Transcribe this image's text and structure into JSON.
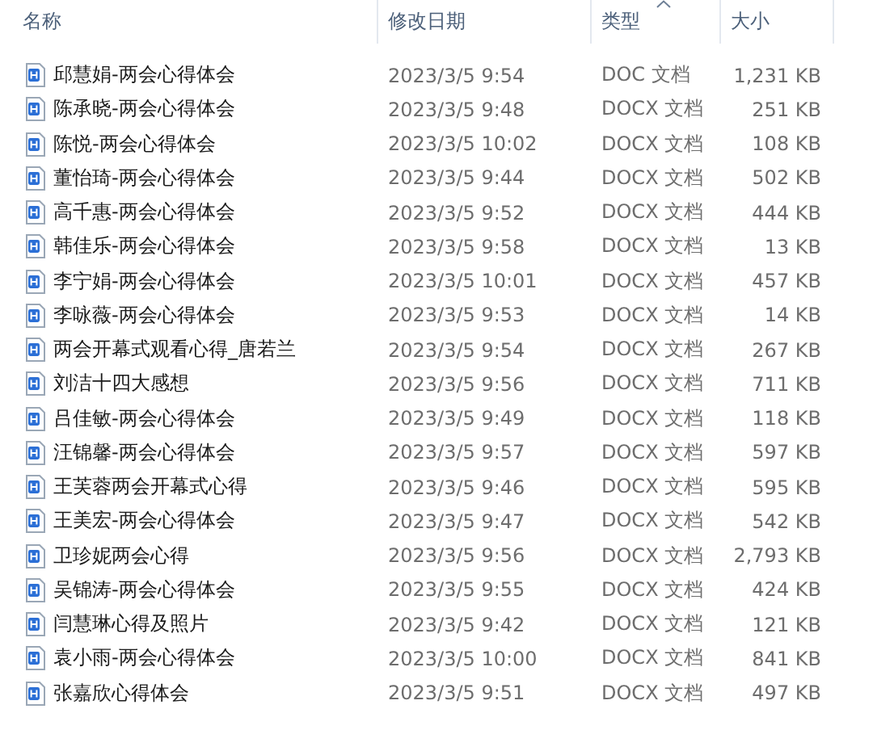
{
  "columns": [
    {
      "label": "名称",
      "sorted": false
    },
    {
      "label": "修改日期",
      "sorted": false
    },
    {
      "label": "类型",
      "sorted": true
    },
    {
      "label": "大小",
      "sorted": false
    }
  ],
  "rows": [
    {
      "name": "邱慧娟-两会心得体会",
      "modified": "2023/3/5 9:54",
      "type": "DOC 文档",
      "size": "1,231 KB"
    },
    {
      "name": "陈承晓-两会心得体会",
      "modified": "2023/3/5 9:48",
      "type": "DOCX 文档",
      "size": "251 KB"
    },
    {
      "name": "陈悦-两会心得体会",
      "modified": "2023/3/5 10:02",
      "type": "DOCX 文档",
      "size": "108 KB"
    },
    {
      "name": "董怡琦-两会心得体会",
      "modified": "2023/3/5 9:44",
      "type": "DOCX 文档",
      "size": "502 KB"
    },
    {
      "name": "高千惠-两会心得体会",
      "modified": "2023/3/5 9:52",
      "type": "DOCX 文档",
      "size": "444 KB"
    },
    {
      "name": "韩佳乐-两会心得体会",
      "modified": "2023/3/5 9:58",
      "type": "DOCX 文档",
      "size": "13 KB"
    },
    {
      "name": "李宁娟-两会心得体会",
      "modified": "2023/3/5 10:01",
      "type": "DOCX 文档",
      "size": "457 KB"
    },
    {
      "name": "李咏薇-两会心得体会",
      "modified": "2023/3/5 9:53",
      "type": "DOCX 文档",
      "size": "14 KB"
    },
    {
      "name": "两会开幕式观看心得_唐若兰",
      "modified": "2023/3/5 9:54",
      "type": "DOCX 文档",
      "size": "267 KB"
    },
    {
      "name": "刘洁十四大感想",
      "modified": "2023/3/5 9:56",
      "type": "DOCX 文档",
      "size": "711 KB"
    },
    {
      "name": "吕佳敏-两会心得体会",
      "modified": "2023/3/5 9:49",
      "type": "DOCX 文档",
      "size": "118 KB"
    },
    {
      "name": "汪锦馨-两会心得体会",
      "modified": "2023/3/5 9:57",
      "type": "DOCX 文档",
      "size": "597 KB"
    },
    {
      "name": "王芙蓉两会开幕式心得",
      "modified": "2023/3/5 9:46",
      "type": "DOCX 文档",
      "size": "595 KB"
    },
    {
      "name": "王美宏-两会心得体会",
      "modified": "2023/3/5 9:47",
      "type": "DOCX 文档",
      "size": "542 KB"
    },
    {
      "name": "卫珍妮两会心得",
      "modified": "2023/3/5 9:56",
      "type": "DOCX 文档",
      "size": "2,793 KB"
    },
    {
      "name": "吴锦涛-两会心得体会",
      "modified": "2023/3/5 9:55",
      "type": "DOCX 文档",
      "size": "424 KB"
    },
    {
      "name": "闫慧琳心得及照片",
      "modified": "2023/3/5 9:42",
      "type": "DOCX 文档",
      "size": "121 KB"
    },
    {
      "name": "袁小雨-两会心得体会",
      "modified": "2023/3/5 10:00",
      "type": "DOCX 文档",
      "size": "841 KB"
    },
    {
      "name": "张嘉欣心得体会",
      "modified": "2023/3/5 9:51",
      "type": "DOCX 文档",
      "size": "497 KB"
    }
  ]
}
